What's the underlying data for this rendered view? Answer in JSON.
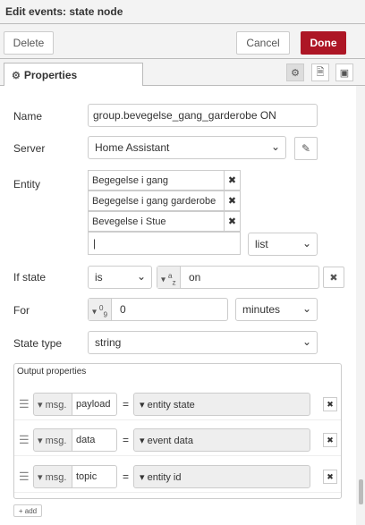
{
  "header": {
    "title": "Edit events: state node"
  },
  "toolbar": {
    "delete_label": "Delete",
    "cancel_label": "Cancel",
    "done_label": "Done"
  },
  "tabs": {
    "properties_label": "Properties"
  },
  "form": {
    "name_label": "Name",
    "name_value": "group.bevegelse_gang_garderobe ON",
    "server_label": "Server",
    "server_value": "Home Assistant",
    "entity_label": "Entity",
    "entities": [
      "Begegelse i gang",
      "Begegelse i gang garderobe",
      "Bevegelse i Stue"
    ],
    "entity_match": "list",
    "if_state_label": "If state",
    "if_state_operator": "is",
    "if_state_type_sub": "a",
    "if_state_type_sub2": "z",
    "if_state_value": "on",
    "for_label": "For",
    "for_type_sub": "0",
    "for_type_sub2": "9",
    "for_value": "0",
    "for_unit": "minutes",
    "state_type_label": "State type",
    "state_type_value": "string"
  },
  "output": {
    "legend": "Output properties",
    "prefix": "msg.",
    "rows": [
      {
        "property": "payload",
        "value": "entity state"
      },
      {
        "property": "data",
        "value": "event data"
      },
      {
        "property": "topic",
        "value": "entity id"
      }
    ],
    "add_label": "add"
  }
}
